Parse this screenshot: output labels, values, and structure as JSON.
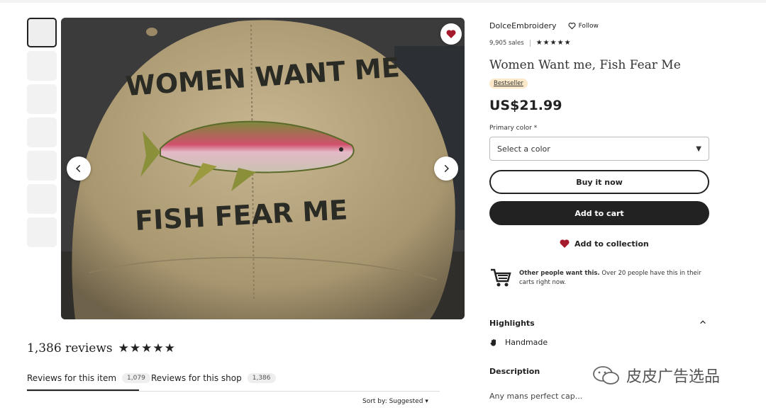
{
  "gallery": {
    "thumbnail_count": 7,
    "image_text_top": "WOMEN WANT ME",
    "image_text_bottom": "FISH FEAR ME"
  },
  "reviews": {
    "title": "1,386 reviews",
    "stars": "★★★★★",
    "tabs": [
      {
        "label": "Reviews for this item",
        "count": "1,079"
      },
      {
        "label": "Reviews for this shop",
        "count": "1,386"
      }
    ],
    "sort_label": "Sort by: Suggested"
  },
  "shop": {
    "name": "DolceEmbroidery",
    "follow_label": "Follow",
    "sales": "9,905 sales",
    "stars": "★★★★★"
  },
  "product": {
    "title": "Women Want me, Fish Fear Me",
    "badge": "Bestseller",
    "price": "US$21.99",
    "color_label": "Primary color",
    "required_mark": "*",
    "color_placeholder": "Select a color"
  },
  "actions": {
    "buy_now": "Buy it now",
    "add_to_cart": "Add to cart",
    "add_to_collection": "Add to collection"
  },
  "demand": {
    "bold": "Other people want this.",
    "text": " Over 20 people have this in their carts right now."
  },
  "highlights": {
    "title": "Highlights",
    "item": "Handmade"
  },
  "description": {
    "title": "Description",
    "text": "Any mans perfect cap..."
  },
  "watermark": "皮皮广告选品",
  "colors": {
    "primary": "#222222",
    "favorite_red": "#a61a2e",
    "badge_bg": "#fbe8c8",
    "cap_fabric": "#b4a27e"
  },
  "icons": [
    "heart-icon",
    "chevron-left-icon",
    "chevron-right-icon",
    "caret-down-icon",
    "cart-icon",
    "hand-icon",
    "chevron-up-icon"
  ]
}
